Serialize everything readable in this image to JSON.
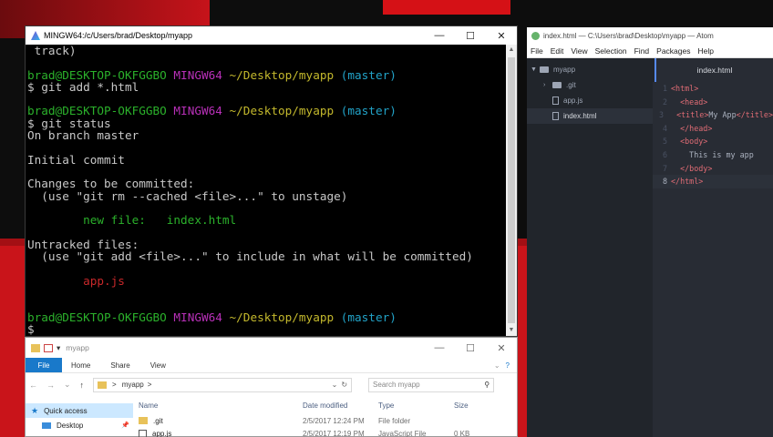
{
  "terminal": {
    "title": "MINGW64:/c/Users/brad/Desktop/myapp",
    "controls": [
      "—",
      "☐",
      "✕"
    ],
    "lines": [
      [
        {
          "t": " track)",
          "c": "c-white"
        }
      ],
      [
        {
          "t": "",
          "c": "c-white"
        }
      ],
      [
        {
          "t": "brad@DESKTOP-OKFGGBO",
          "c": "c-green"
        },
        {
          "t": " MINGW64",
          "c": "c-mag"
        },
        {
          "t": " ~/Desktop/myapp",
          "c": "c-yel"
        },
        {
          "t": " (master)",
          "c": "c-cyan"
        }
      ],
      [
        {
          "t": "$ git add *.html",
          "c": "c-white"
        }
      ],
      [
        {
          "t": "",
          "c": "c-white"
        }
      ],
      [
        {
          "t": "brad@DESKTOP-OKFGGBO",
          "c": "c-green"
        },
        {
          "t": " MINGW64",
          "c": "c-mag"
        },
        {
          "t": " ~/Desktop/myapp",
          "c": "c-yel"
        },
        {
          "t": " (master)",
          "c": "c-cyan"
        }
      ],
      [
        {
          "t": "$ git status",
          "c": "c-white"
        }
      ],
      [
        {
          "t": "On branch master",
          "c": "c-white"
        }
      ],
      [
        {
          "t": "",
          "c": "c-white"
        }
      ],
      [
        {
          "t": "Initial commit",
          "c": "c-white"
        }
      ],
      [
        {
          "t": "",
          "c": "c-white"
        }
      ],
      [
        {
          "t": "Changes to be committed:",
          "c": "c-white"
        }
      ],
      [
        {
          "t": "  (use \"git rm --cached <file>...\" to unstage)",
          "c": "c-white"
        }
      ],
      [
        {
          "t": "",
          "c": "c-white"
        }
      ],
      [
        {
          "t": "        new file:   index.html",
          "c": "c-green"
        }
      ],
      [
        {
          "t": "",
          "c": "c-white"
        }
      ],
      [
        {
          "t": "Untracked files:",
          "c": "c-white"
        }
      ],
      [
        {
          "t": "  (use \"git add <file>...\" to include in what will be committed)",
          "c": "c-white"
        }
      ],
      [
        {
          "t": "",
          "c": "c-white"
        }
      ],
      [
        {
          "t": "        app.js",
          "c": "c-red"
        }
      ],
      [
        {
          "t": "",
          "c": "c-white"
        }
      ],
      [
        {
          "t": "",
          "c": "c-white"
        }
      ],
      [
        {
          "t": "brad@DESKTOP-OKFGGBO",
          "c": "c-green"
        },
        {
          "t": " MINGW64",
          "c": "c-mag"
        },
        {
          "t": " ~/Desktop/myapp",
          "c": "c-yel"
        },
        {
          "t": " (master)",
          "c": "c-cyan"
        }
      ],
      [
        {
          "t": "$",
          "c": "c-white"
        }
      ]
    ]
  },
  "atom": {
    "title": "index.html — C:\\Users\\brad\\Desktop\\myapp — Atom",
    "menu": [
      "File",
      "Edit",
      "View",
      "Selection",
      "Find",
      "Packages",
      "Help"
    ],
    "tree": {
      "root": "myapp",
      "items": [
        {
          "label": ".git",
          "kind": "folder"
        },
        {
          "label": "app.js",
          "kind": "file"
        },
        {
          "label": "index.html",
          "kind": "file",
          "selected": true
        }
      ]
    },
    "tab": "index.html",
    "code": [
      {
        "n": "1",
        "parts": [
          [
            "tag",
            "<html>"
          ]
        ]
      },
      {
        "n": "2",
        "parts": [
          [
            "br",
            "  "
          ],
          [
            "tag",
            "<head>"
          ]
        ]
      },
      {
        "n": "3",
        "parts": [
          [
            "br",
            "  "
          ],
          [
            "tag",
            "<title>"
          ],
          [
            "br",
            "My App"
          ],
          [
            "tag",
            "</title>"
          ]
        ]
      },
      {
        "n": "4",
        "parts": [
          [
            "br",
            "  "
          ],
          [
            "tag",
            "</head>"
          ]
        ]
      },
      {
        "n": "5",
        "parts": [
          [
            "br",
            "  "
          ],
          [
            "tag",
            "<body>"
          ]
        ]
      },
      {
        "n": "6",
        "parts": [
          [
            "br",
            "    This is my app"
          ]
        ]
      },
      {
        "n": "7",
        "parts": [
          [
            "br",
            "  "
          ],
          [
            "tag",
            "</body>"
          ]
        ]
      },
      {
        "n": "8",
        "parts": [
          [
            "tag",
            "</html>"
          ]
        ],
        "current": true
      }
    ]
  },
  "explorer": {
    "title": "myapp",
    "ribbon": {
      "file": "File",
      "tabs": [
        "Home",
        "Share",
        "View"
      ]
    },
    "address": "myapp",
    "address_sep": ">",
    "search_placeholder": "Search myapp",
    "nav": [
      {
        "label": "Quick access",
        "icon": "star-icon",
        "selected": true
      },
      {
        "label": "Desktop",
        "icon": "desktop-icon",
        "pin": true
      }
    ],
    "columns": [
      "Name",
      "Date modified",
      "Type",
      "Size"
    ],
    "rows": [
      {
        "name": ".git",
        "date": "2/5/2017 12:24 PM",
        "type": "File folder",
        "size": "",
        "kind": "folder"
      },
      {
        "name": "app.js",
        "date": "2/5/2017 12:19 PM",
        "type": "JavaScript File",
        "size": "0 KB",
        "kind": "js"
      }
    ]
  }
}
